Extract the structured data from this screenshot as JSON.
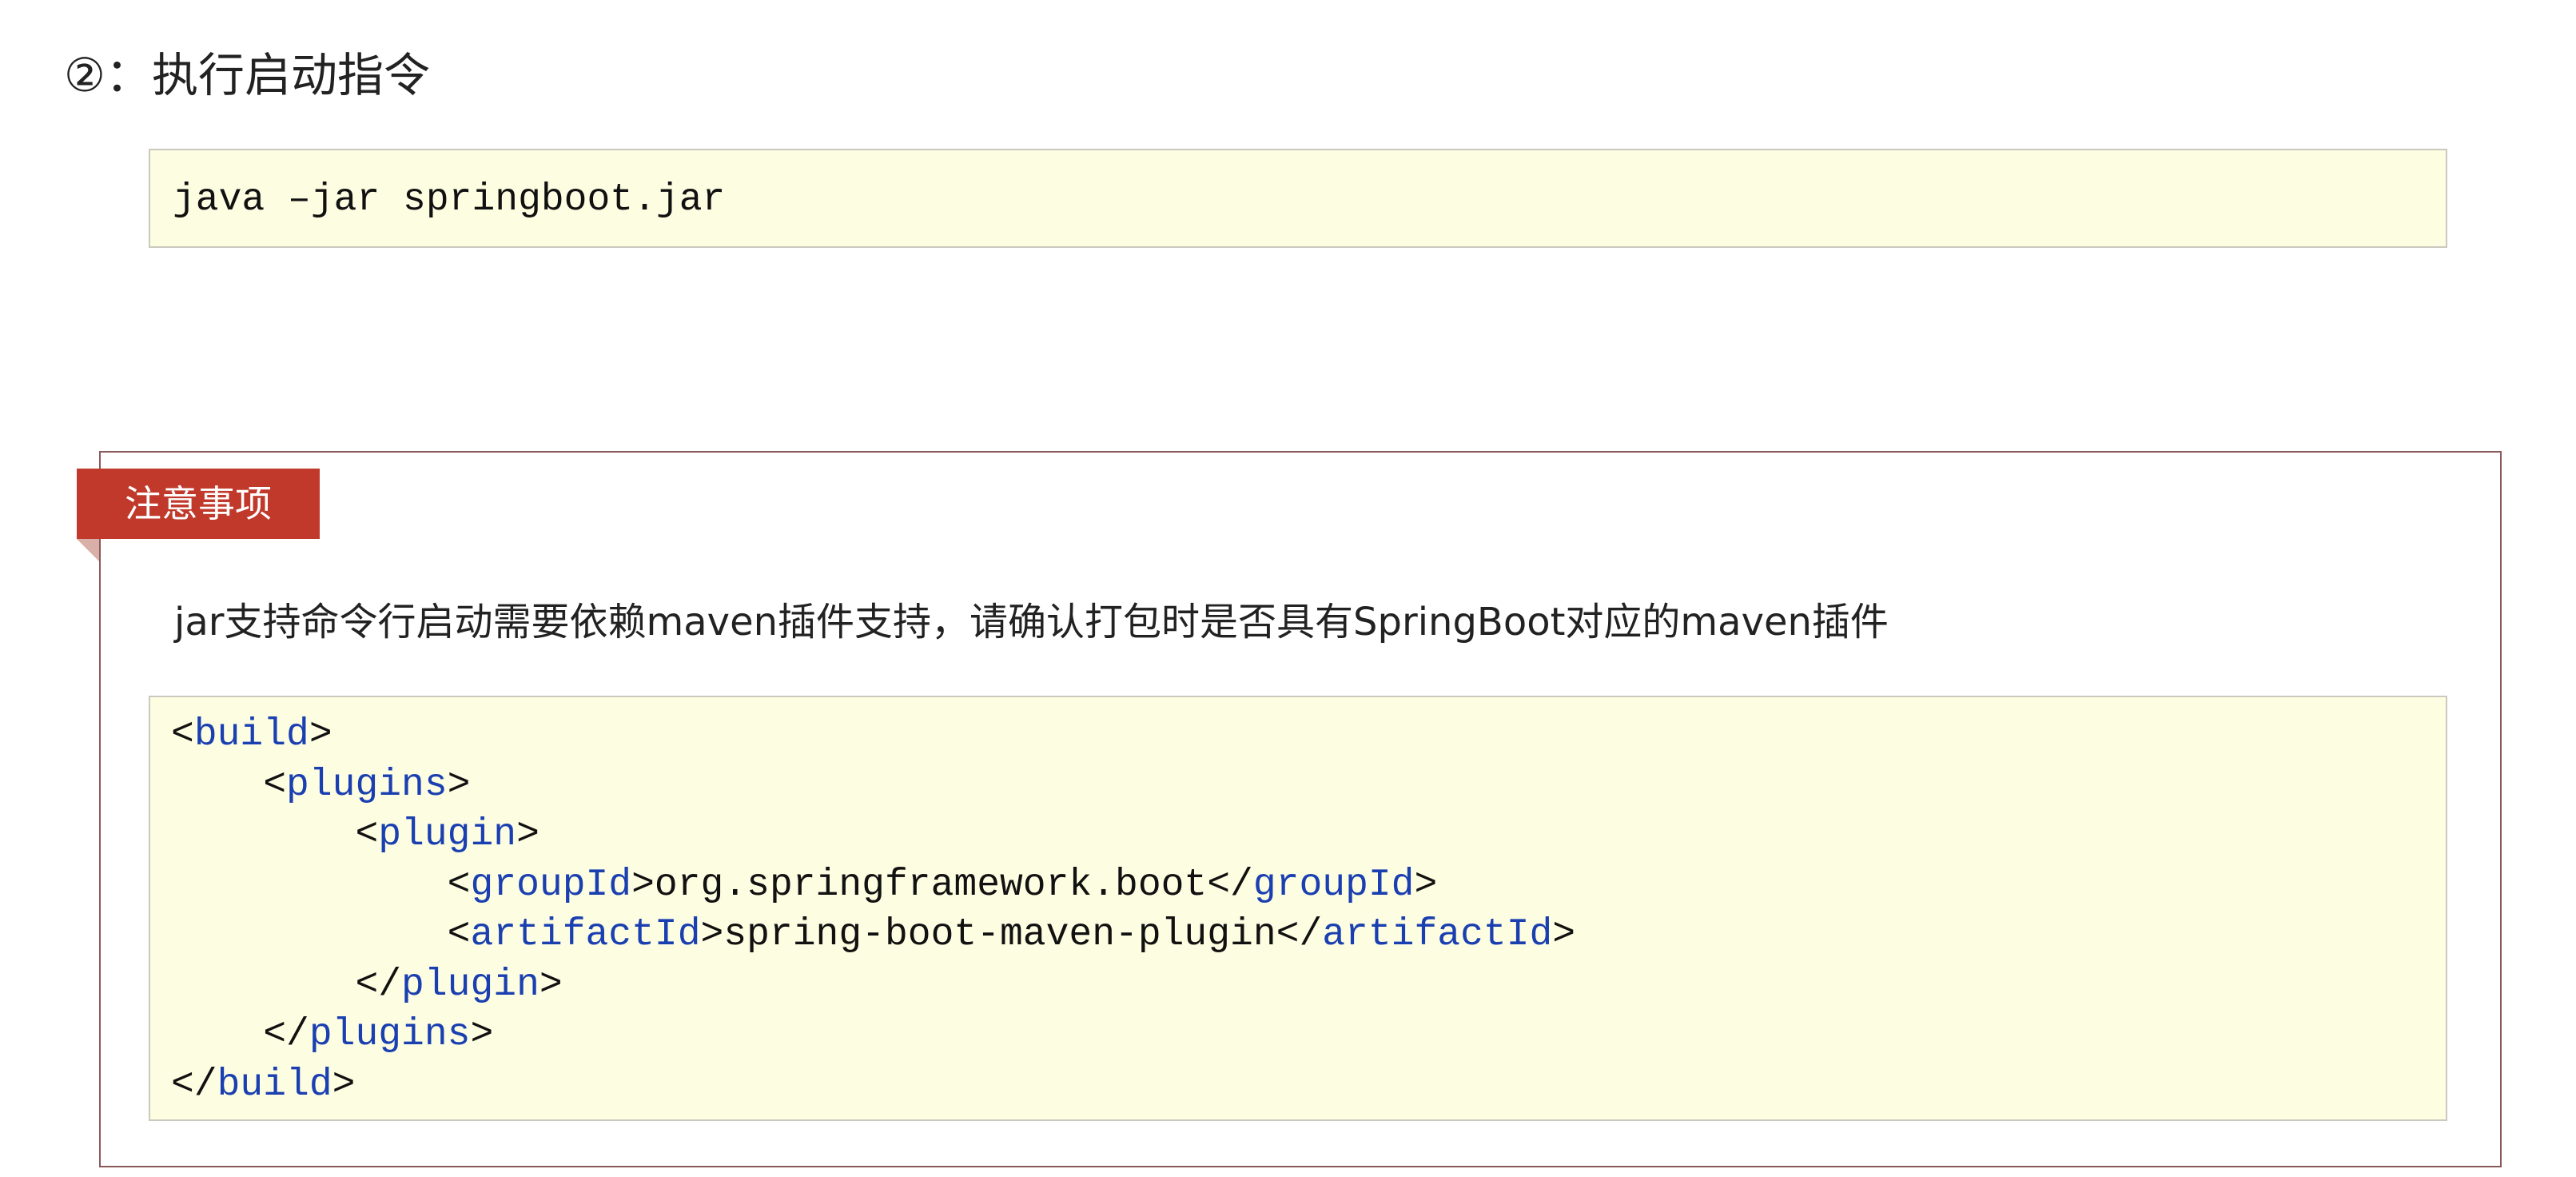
{
  "heading": {
    "text": "②：执行启动指令"
  },
  "command": {
    "text": "java –jar springboot.jar"
  },
  "note": {
    "tab_label": "注意事项",
    "description": "jar支持命令行启动需要依赖maven插件支持，请确认打包时是否具有SpringBoot对应的maven插件"
  },
  "xml": {
    "lines": [
      {
        "indent": "",
        "open": "<",
        "name": "build",
        "close": ">",
        "value": "",
        "end_open": "",
        "end_name": "",
        "end_close": ""
      },
      {
        "indent": "    ",
        "open": "<",
        "name": "plugins",
        "close": ">",
        "value": "",
        "end_open": "",
        "end_name": "",
        "end_close": ""
      },
      {
        "indent": "        ",
        "open": "<",
        "name": "plugin",
        "close": ">",
        "value": "",
        "end_open": "",
        "end_name": "",
        "end_close": ""
      },
      {
        "indent": "            ",
        "open": "<",
        "name": "groupId",
        "close": ">",
        "value": "org.springframework.boot",
        "end_open": "</",
        "end_name": "groupId",
        "end_close": ">"
      },
      {
        "indent": "            ",
        "open": "<",
        "name": "artifactId",
        "close": ">",
        "value": "spring-boot-maven-plugin",
        "end_open": "</",
        "end_name": "artifactId",
        "end_close": ">"
      },
      {
        "indent": "        ",
        "open": "</",
        "name": "plugin",
        "close": ">",
        "value": "",
        "end_open": "",
        "end_name": "",
        "end_close": ""
      },
      {
        "indent": "    ",
        "open": "</",
        "name": "plugins",
        "close": ">",
        "value": "",
        "end_open": "",
        "end_name": "",
        "end_close": ""
      },
      {
        "indent": "",
        "open": "</",
        "name": "build",
        "close": ">",
        "value": "",
        "end_open": "",
        "end_name": "",
        "end_close": ""
      }
    ]
  },
  "colors": {
    "code_background": "#fdfde2",
    "tag_name": "#1a3fb0",
    "note_tab": "#c0392b",
    "note_border": "#8a5a5a"
  }
}
